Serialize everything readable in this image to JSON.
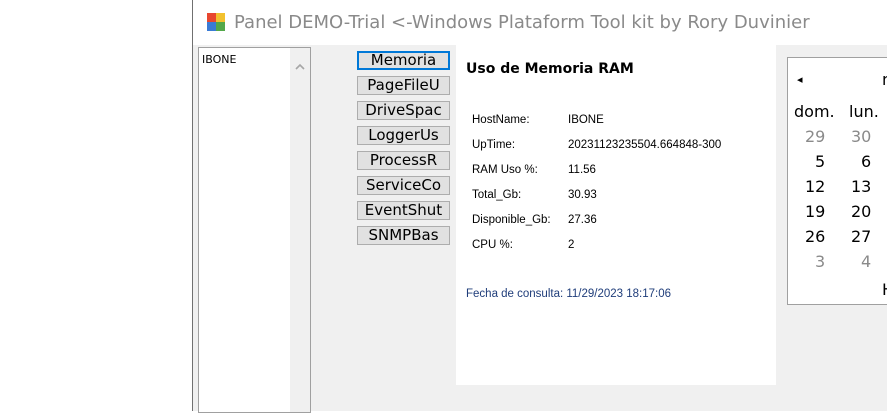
{
  "window": {
    "title": "Panel DEMO-Trial <-Windows Plataform Tool kit by Rory Duvinier"
  },
  "hosts_list": {
    "items": [
      "IBONE"
    ]
  },
  "buttons": [
    "Memoria",
    "PageFileU",
    "DriveSpac",
    "LoggerUs",
    "ProcessR",
    "ServiceCo",
    "EventShut",
    "SNMPBas"
  ],
  "content": {
    "title": "Uso de Memoria RAM",
    "rows": [
      {
        "label": "HostName:",
        "value": "IBONE"
      },
      {
        "label": "UpTime:",
        "value": "20231123235504.664848-300"
      },
      {
        "label": "RAM Uso %:",
        "value": "11.56"
      },
      {
        "label": "Total_Gb:",
        "value": "30.93"
      },
      {
        "label": "Disponible_Gb:",
        "value": "27.36"
      },
      {
        "label": "CPU %:",
        "value": "2"
      }
    ],
    "consult_text": "Fecha de consulta: 11/29/2023 18:17:06"
  },
  "calendar": {
    "prev_symbol": "◂",
    "month_partial": "n",
    "day_headers": [
      "dom.",
      "lun."
    ],
    "weeks": [
      [
        "29",
        "30"
      ],
      [
        "5",
        "6"
      ],
      [
        "12",
        "13"
      ],
      [
        "19",
        "20"
      ],
      [
        "26",
        "27"
      ],
      [
        "3",
        "4"
      ]
    ],
    "other_month_weeks": [
      0,
      5
    ],
    "footer_partial": "H"
  },
  "colors": {
    "focus_border": "#0078d7",
    "consult_text": "#1f3d7a",
    "muted_day": "#8a8a8a"
  }
}
